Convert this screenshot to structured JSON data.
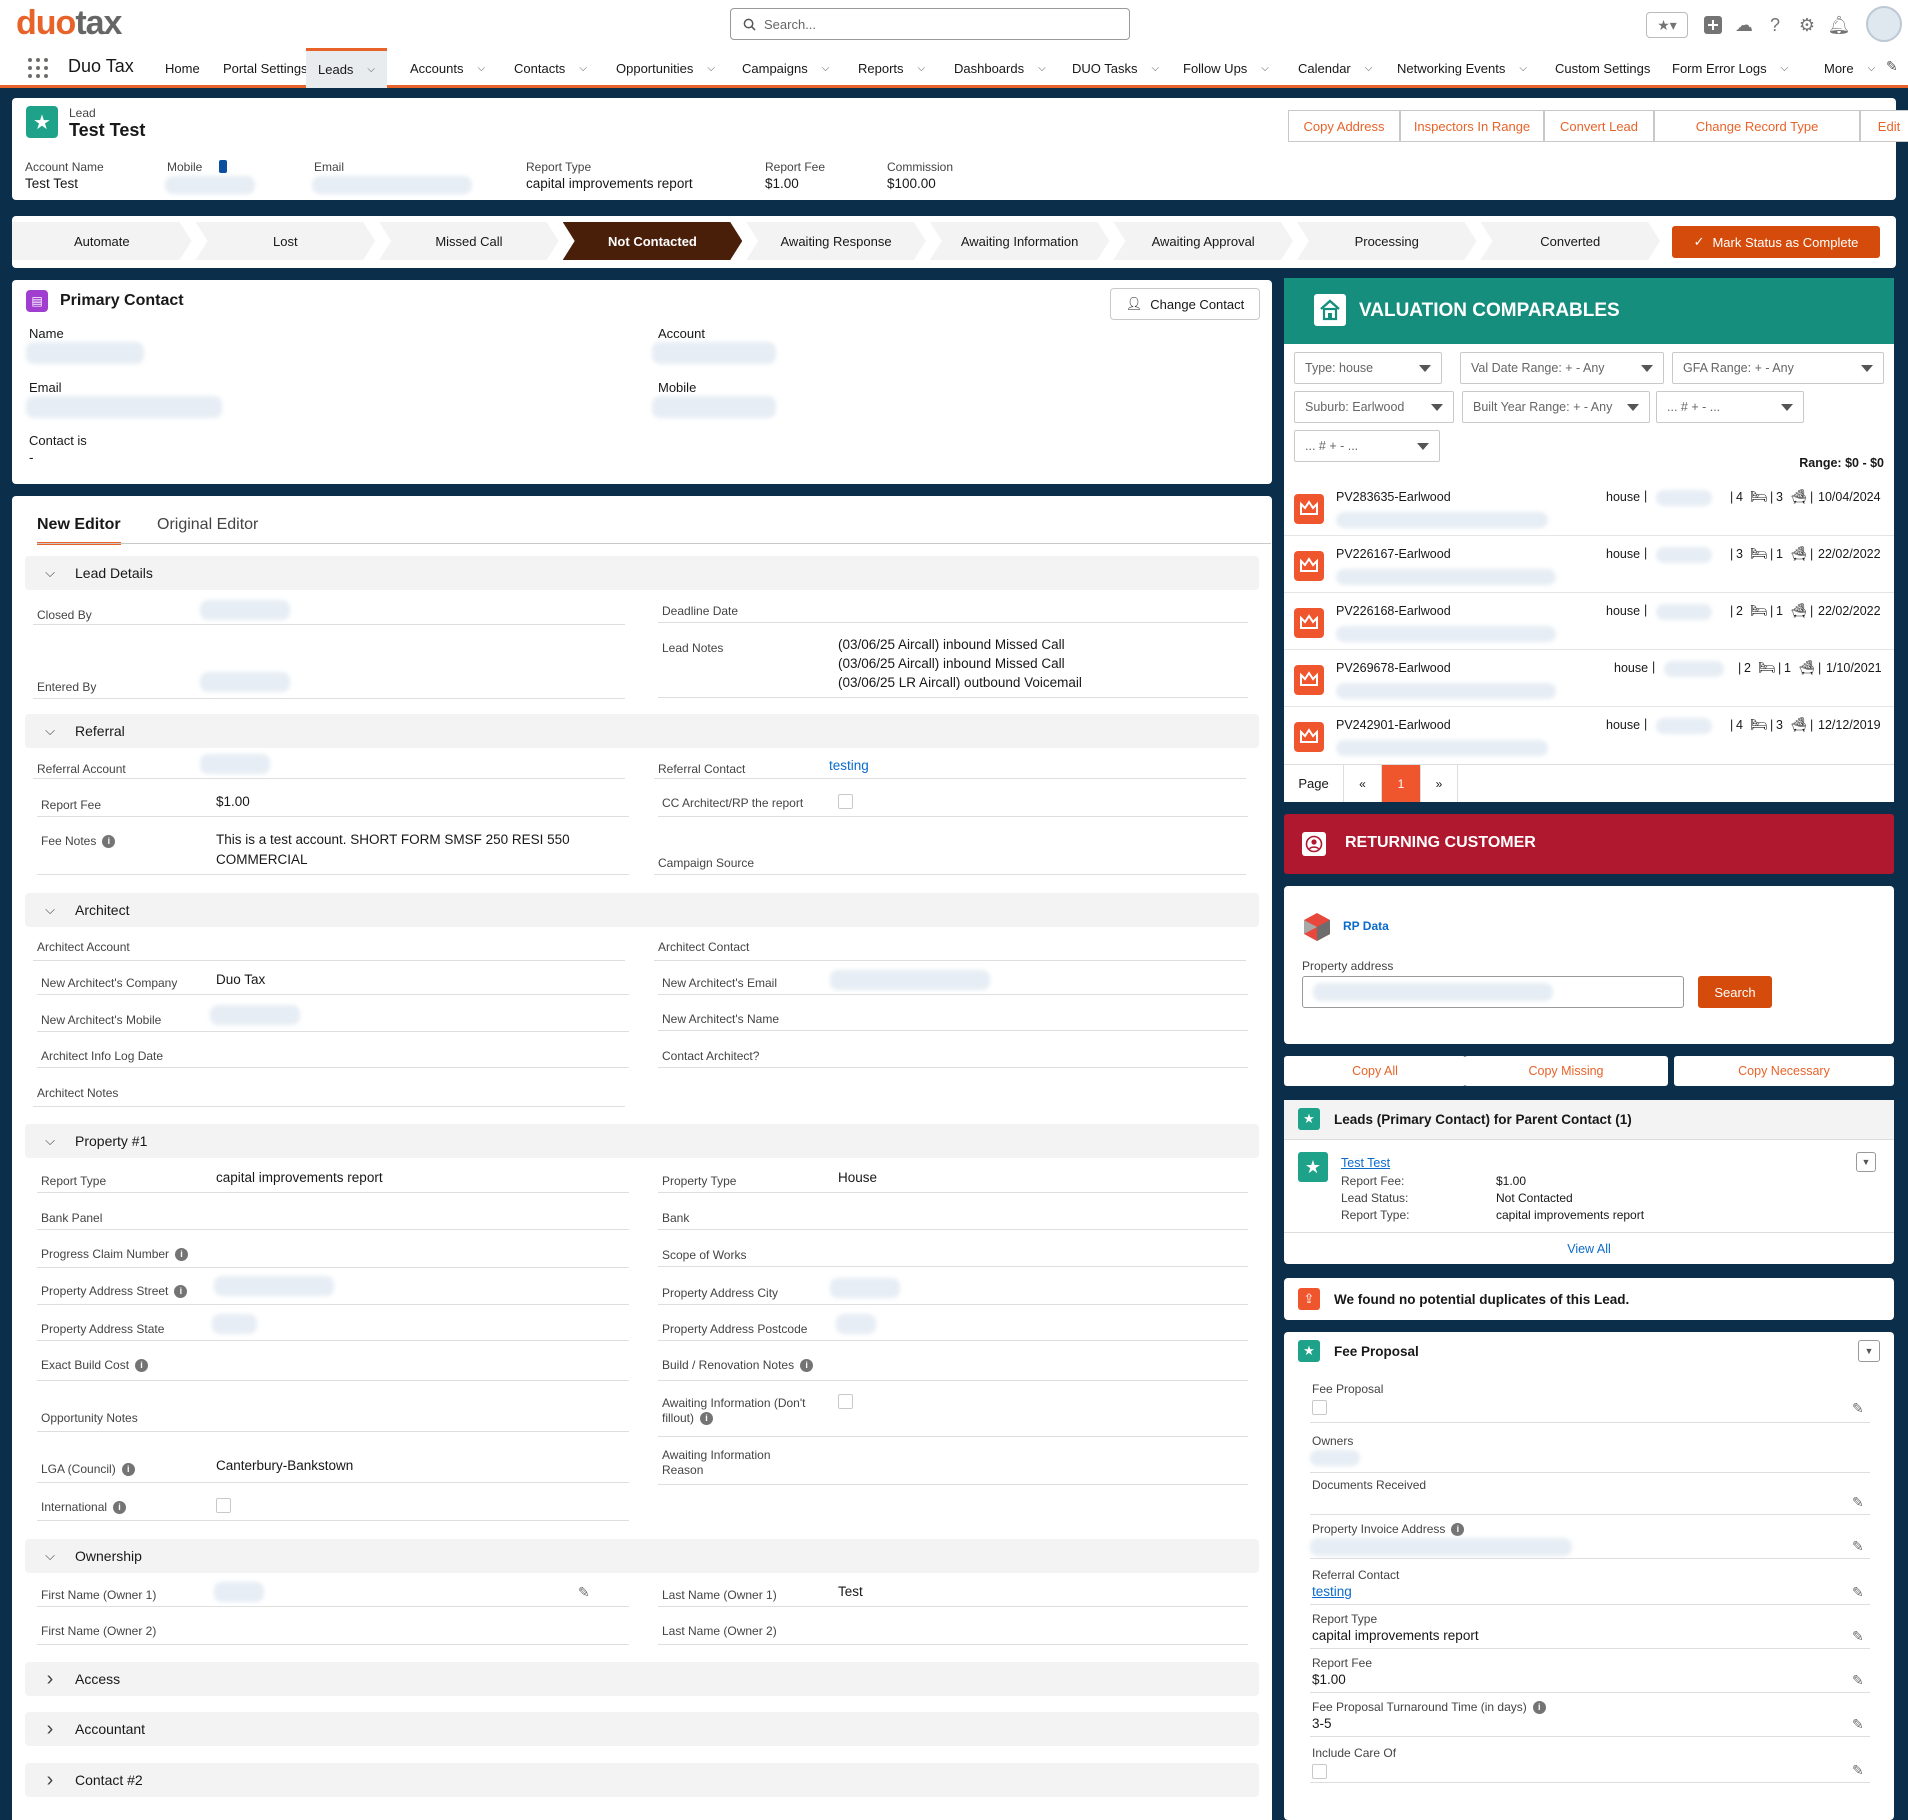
{
  "brand": {
    "logo_a": "duo",
    "logo_b": "tax",
    "app_name": "Duo Tax",
    "accent": "#e8632a",
    "navy": "#0b2e4a"
  },
  "search": {
    "placeholder": "Search..."
  },
  "nav": [
    {
      "label": "Home",
      "chev": false
    },
    {
      "label": "Portal Settings",
      "chev": false
    },
    {
      "label": "Leads",
      "chev": true,
      "active": true
    },
    {
      "label": "Accounts",
      "chev": true
    },
    {
      "label": "Contacts",
      "chev": true
    },
    {
      "label": "Opportunities",
      "chev": true
    },
    {
      "label": "Campaigns",
      "chev": true
    },
    {
      "label": "Reports",
      "chev": true
    },
    {
      "label": "Dashboards",
      "chev": true
    },
    {
      "label": "DUO Tasks",
      "chev": true
    },
    {
      "label": "Follow Ups",
      "chev": true
    },
    {
      "label": "Calendar",
      "chev": true
    },
    {
      "label": "Networking Events",
      "chev": true
    },
    {
      "label": "Custom Settings",
      "chev": false
    },
    {
      "label": "Form Error Logs",
      "chev": true
    },
    {
      "label": "More",
      "chev": true
    }
  ],
  "record": {
    "object": "Lead",
    "name": "Test Test",
    "actions": [
      "Copy Address",
      "Inspectors In Range",
      "Convert Lead",
      "Change Record Type",
      "Edit"
    ],
    "highlights": [
      {
        "label": "Account Name",
        "value": "Test Test"
      },
      {
        "label": "Mobile",
        "value": ""
      },
      {
        "label": "Email",
        "value": ""
      },
      {
        "label": "Report Type",
        "value": "capital improvements report"
      },
      {
        "label": "Report Fee",
        "value": "$1.00"
      },
      {
        "label": "Commission",
        "value": "$100.00"
      }
    ]
  },
  "path": {
    "steps": [
      "Automate",
      "Lost",
      "Missed Call",
      "Not Contacted",
      "Awaiting Response",
      "Awaiting Information",
      "Awaiting Approval",
      "Processing",
      "Converted"
    ],
    "current": "Not Contacted",
    "complete_btn": "Mark Status as Complete"
  },
  "primary_contact": {
    "title": "Primary Contact",
    "change_btn": "Change Contact",
    "name_label": "Name",
    "account_label": "Account",
    "email_label": "Email",
    "mobile_label": "Mobile",
    "contact_is_label": "Contact is",
    "contact_is_value": "-"
  },
  "editor": {
    "tab_new": "New Editor",
    "tab_orig": "Original Editor"
  },
  "sections": {
    "lead_details": "Lead Details",
    "referral": "Referral",
    "architect": "Architect",
    "property": "Property #1",
    "ownership": "Ownership",
    "access": "Access",
    "accountant": "Accountant",
    "contact2": "Contact #2"
  },
  "fields": {
    "closed_by": "Closed By",
    "entered_by": "Entered By",
    "deadline_date": "Deadline Date",
    "lead_notes": "Lead Notes",
    "lead_notes_lines": [
      "(03/06/25 Aircall) inbound Missed Call",
      "(03/06/25 Aircall) inbound Missed Call",
      "(03/06/25 LR Aircall) outbound Voicemail"
    ],
    "referral_account": "Referral Account",
    "referral_contact": "Referral Contact",
    "referral_contact_val": "testing",
    "report_fee": "Report Fee",
    "report_fee_val": "$1.00",
    "cc_architect": "CC Architect/RP the report",
    "fee_notes": "Fee Notes",
    "fee_notes_val1": "This is a test account. SHORT FORM SMSF 250 RESI 550",
    "fee_notes_val2": "COMMERCIAL",
    "campaign_source": "Campaign Source",
    "architect_account": "Architect Account",
    "architect_contact": "Architect Contact",
    "new_arch_company": "New Architect's Company",
    "new_arch_company_val": "Duo Tax",
    "new_arch_email": "New Architect's Email",
    "new_arch_mobile": "New Architect's Mobile",
    "new_arch_name": "New Architect's Name",
    "arch_info_log": "Architect Info Log Date",
    "contact_architect": "Contact Architect?",
    "architect_notes": "Architect Notes",
    "report_type": "Report Type",
    "report_type_val": "capital improvements report",
    "property_type": "Property Type",
    "property_type_val": "House",
    "bank_panel": "Bank Panel",
    "bank": "Bank",
    "progress_claim": "Progress Claim Number",
    "scope_of_works": "Scope of Works",
    "addr_street": "Property Address Street",
    "addr_city": "Property Address City",
    "addr_state": "Property Address State",
    "addr_postcode": "Property Address Postcode",
    "exact_build": "Exact Build Cost",
    "build_notes": "Build / Renovation Notes",
    "opp_notes": "Opportunity Notes",
    "awaiting_info": "Awaiting Information (Don't fillout)",
    "awaiting_reason": "Awaiting Information Reason",
    "lga": "LGA (Council)",
    "lga_val": "Canterbury-Bankstown",
    "international": "International",
    "first_owner1": "First Name (Owner 1)",
    "last_owner1": "Last Name (Owner 1)",
    "last_owner1_val": "Test",
    "first_owner2": "First Name (Owner 2)",
    "last_owner2": "Last Name (Owner 2)"
  },
  "valuation": {
    "title": "VALUATION COMPARABLES",
    "filters": [
      "Type: house",
      "Val Date Range: + - Any",
      "GFA Range: + - Any",
      "Suburb: Earlwood",
      "Built Year Range: + - Any",
      "... # + - ...",
      "... # + - ..."
    ],
    "range": "Range: $0 - $0",
    "rows": [
      {
        "id": "PV283635-Earlwood",
        "type": "house",
        "beds": "4",
        "baths": "3",
        "date": "10/04/2024"
      },
      {
        "id": "PV226167-Earlwood",
        "type": "house",
        "beds": "3",
        "baths": "1",
        "date": "22/02/2022"
      },
      {
        "id": "PV226168-Earlwood",
        "type": "house",
        "beds": "2",
        "baths": "1",
        "date": "22/02/2022"
      },
      {
        "id": "PV269678-Earlwood",
        "type": "house",
        "beds": "2",
        "baths": "1",
        "date": "1/10/2021"
      },
      {
        "id": "PV242901-Earlwood",
        "type": "house",
        "beds": "4",
        "baths": "3",
        "date": "12/12/2019"
      }
    ],
    "page_label": "Page",
    "prev": "«",
    "page": "1",
    "next": "»"
  },
  "returning": {
    "title": "RETURNING CUSTOMER",
    "color": "#b0182f"
  },
  "rpdata": {
    "title": "RP Data",
    "addr_label": "Property address",
    "search_btn": "Search"
  },
  "copy_btns": [
    "Copy All",
    "Copy Missing",
    "Copy Necessary"
  ],
  "related": {
    "title": "Leads (Primary Contact) for Parent Contact (1)",
    "item_name": "Test Test",
    "rows": [
      {
        "k": "Report Fee:",
        "v": "$1.00"
      },
      {
        "k": "Lead Status:",
        "v": "Not Contacted"
      },
      {
        "k": "Report Type:",
        "v": "capital improvements report"
      }
    ],
    "view_all": "View All"
  },
  "duplicates": {
    "text": "We found no potential duplicates of this Lead."
  },
  "fee_proposal": {
    "title": "Fee Proposal",
    "fields": [
      {
        "label": "Fee Proposal",
        "value": "",
        "checkbox": true
      },
      {
        "label": "Owners",
        "value": ""
      },
      {
        "label": "Documents Received",
        "value": ""
      },
      {
        "label": "Property Invoice Address",
        "value": "",
        "info": true
      },
      {
        "label": "Referral Contact",
        "value": "testing",
        "link": true
      },
      {
        "label": "Report Type",
        "value": "capital improvements report"
      },
      {
        "label": "Report Fee",
        "value": "$1.00"
      },
      {
        "label": "Fee Proposal Turnaround Time (in days)",
        "value": "3-5",
        "info": true
      },
      {
        "label": "Include Care Of",
        "value": "",
        "checkbox": true
      }
    ]
  }
}
